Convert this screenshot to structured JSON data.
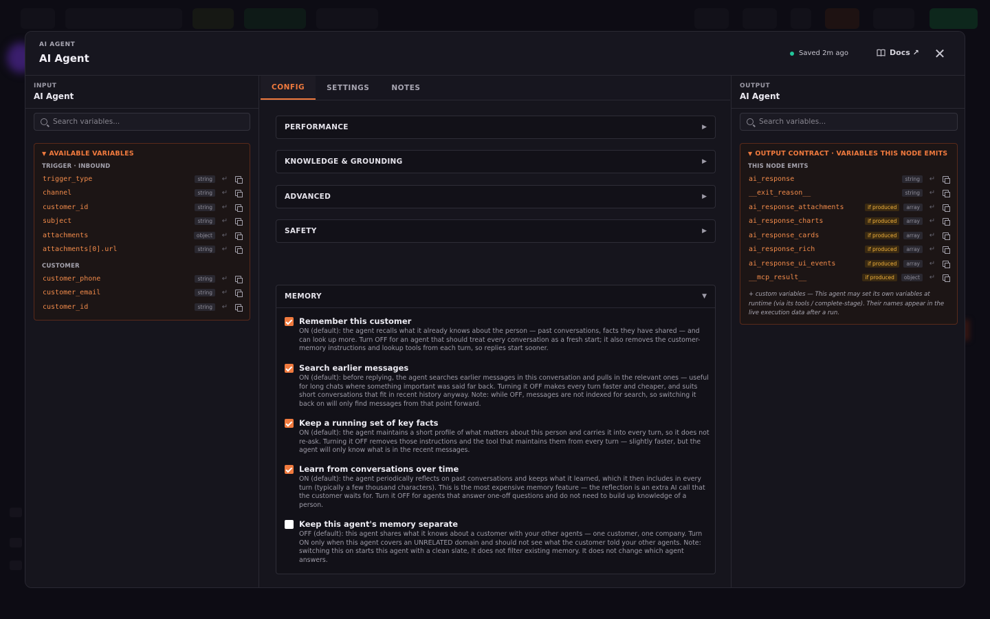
{
  "modal": {
    "eyebrow": "AI AGENT",
    "title": "AI Agent",
    "saved_status": "Saved 2m ago",
    "docs_label": "Docs ↗",
    "close_glyph": "✕"
  },
  "input_panel": {
    "eyebrow": "INPUT",
    "title": "AI Agent",
    "search_placeholder": "Search variables...",
    "box_title": "AVAILABLE VARIABLES",
    "groups": [
      {
        "label": "TRIGGER · INBOUND",
        "vars": [
          {
            "name": "trigger_type",
            "type": "string"
          },
          {
            "name": "channel",
            "type": "string"
          },
          {
            "name": "customer_id",
            "type": "string"
          },
          {
            "name": "subject",
            "type": "string"
          },
          {
            "name": "attachments",
            "type": "object"
          },
          {
            "name": "attachments[0].url",
            "type": "string"
          }
        ]
      },
      {
        "label": "CUSTOMER",
        "vars": [
          {
            "name": "customer_phone",
            "type": "string"
          },
          {
            "name": "customer_email",
            "type": "string"
          },
          {
            "name": "customer_id",
            "type": "string"
          }
        ]
      }
    ]
  },
  "tabs": [
    {
      "label": "CONFIG",
      "active": true
    },
    {
      "label": "SETTINGS",
      "active": false
    },
    {
      "label": "NOTES",
      "active": false
    }
  ],
  "sections": [
    {
      "label": "PERFORMANCE",
      "arrow": "▶"
    },
    {
      "label": "KNOWLEDGE & GROUNDING",
      "arrow": "▶"
    },
    {
      "label": "ADVANCED",
      "arrow": "▶"
    },
    {
      "label": "SAFETY",
      "arrow": "▶"
    }
  ],
  "memory": {
    "label": "MEMORY",
    "arrow": "▼",
    "options": [
      {
        "title": "Remember this customer",
        "checked": true,
        "description": "ON (default): the agent recalls what it already knows about the person — past conversations, facts they have shared — and can look up more. Turn OFF for an agent that should treat every conversation as a fresh start; it also removes the customer-memory instructions and lookup tools from each turn, so replies start sooner."
      },
      {
        "title": "Search earlier messages",
        "checked": true,
        "description": "ON (default): before replying, the agent searches earlier messages in this conversation and pulls in the relevant ones — useful for long chats where something important was said far back. Turning it OFF makes every turn faster and cheaper, and suits short conversations that fit in recent history anyway. Note: while OFF, messages are not indexed for search, so switching it back on will only find messages from that point forward."
      },
      {
        "title": "Keep a running set of key facts",
        "checked": true,
        "description": "ON (default): the agent maintains a short profile of what matters about this person and carries it into every turn, so it does not re-ask. Turning it OFF removes those instructions and the tool that maintains them from every turn — slightly faster, but the agent will only know what is in the recent messages."
      },
      {
        "title": "Learn from conversations over time",
        "checked": true,
        "description": "ON (default): the agent periodically reflects on past conversations and keeps what it learned, which it then includes in every turn (typically a few thousand characters). This is the most expensive memory feature — the reflection is an extra AI call that the customer waits for. Turn it OFF for agents that answer one-off questions and do not need to build up knowledge of a person."
      },
      {
        "title": "Keep this agent's memory separate",
        "checked": false,
        "description": "OFF (default): this agent shares what it knows about a customer with your other agents — one customer, one company. Turn ON only when this agent covers an UNRELATED domain and should not see what the customer told your other agents. Note: switching this on starts this agent with a clean slate, it does not filter existing memory. It does not change which agent answers."
      }
    ]
  },
  "output_panel": {
    "eyebrow": "OUTPUT",
    "title": "AI Agent",
    "search_placeholder": "Search variables...",
    "box_title": "OUTPUT CONTRACT · VARIABLES THIS NODE EMITS",
    "group_label": "THIS NODE EMITS",
    "vars": [
      {
        "name": "ai_response",
        "type": "string",
        "produced": ""
      },
      {
        "name": "__exit_reason__",
        "type": "string",
        "produced": ""
      },
      {
        "name": "ai_response_attachments",
        "type": "array",
        "produced": "if produced"
      },
      {
        "name": "ai_response_charts",
        "type": "array",
        "produced": "if produced"
      },
      {
        "name": "ai_response_cards",
        "type": "array",
        "produced": "if produced"
      },
      {
        "name": "ai_response_rich",
        "type": "array",
        "produced": "if produced"
      },
      {
        "name": "ai_response_ui_events",
        "type": "array",
        "produced": "if produced"
      },
      {
        "name": "__mcp_result__",
        "type": "object",
        "produced": "if produced"
      }
    ],
    "note": "+ custom variables — This agent may set its own variables at runtime (via its tools / complete-stage). Their names appear in the live execution data after a run."
  },
  "colors": {
    "accent": "#f07a3e",
    "saved_dot": "#22c59a",
    "produced_badge": "#f2b13a"
  },
  "icons": {
    "insert": "↵",
    "box_toggle": "▼"
  }
}
